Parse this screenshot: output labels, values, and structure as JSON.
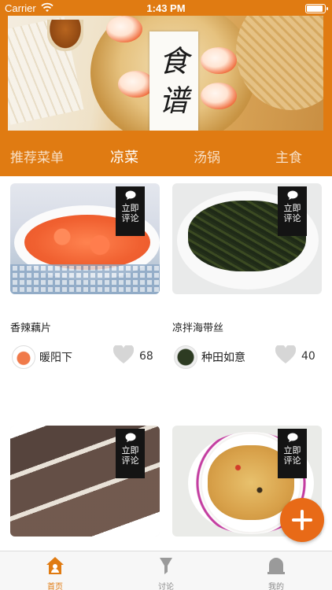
{
  "status_bar": {
    "carrier": "Carrier",
    "time": "1:43 PM"
  },
  "banner": {
    "title_line1": "食",
    "title_line2": "谱"
  },
  "categories": [
    {
      "label": "推荐菜单",
      "active": false
    },
    {
      "label": "凉菜",
      "active": true
    },
    {
      "label": "汤锅",
      "active": false
    },
    {
      "label": "主食",
      "active": false
    }
  ],
  "discuss_label": {
    "line1": "立即",
    "line2": "评论"
  },
  "recipes": [
    {
      "name": "香辣藕片",
      "author": "暖阳下",
      "likes": "68"
    },
    {
      "name": "凉拌海带丝",
      "author": "种田如意",
      "likes": "40"
    },
    {
      "name": "",
      "author": "",
      "likes": ""
    },
    {
      "name": "",
      "author": "",
      "likes": ""
    }
  ],
  "tabbar": [
    {
      "label": "首页",
      "icon": "home-icon",
      "active": true
    },
    {
      "label": "讨论",
      "icon": "discuss-icon",
      "active": false
    },
    {
      "label": "我的",
      "icon": "profile-icon",
      "active": false
    }
  ],
  "colors": {
    "accent": "#e07b12",
    "fab": "#e86a17"
  }
}
